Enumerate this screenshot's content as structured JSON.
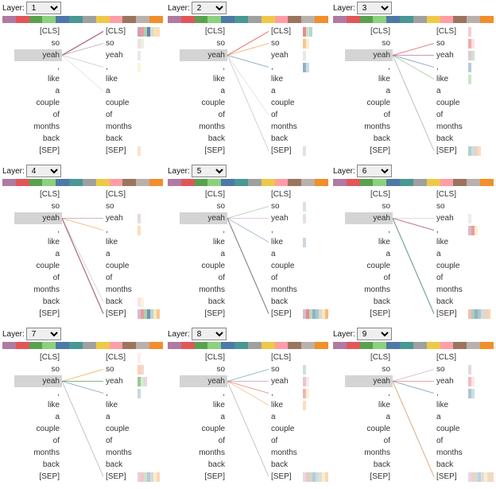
{
  "label_prefix": "Layer:",
  "layers": [
    "1",
    "2",
    "3",
    "4",
    "5",
    "6",
    "7",
    "8",
    "9"
  ],
  "tokens": [
    "[CLS]",
    "so",
    "yeah",
    ",",
    "like",
    "a",
    "couple",
    "of",
    "months",
    "back",
    "[SEP]"
  ],
  "selected_src_idx": 2,
  "head_colors": [
    "#b07aa1",
    "#e15759",
    "#59a14f",
    "#8cd17d",
    "#4e79a7",
    "#499894",
    "#a0a0a0",
    "#edc948",
    "#ff9da7",
    "#9c755f",
    "#bab0ac",
    "#f28e2b"
  ],
  "panels": [
    {
      "highlight_targets": [
        0
      ],
      "lines": [
        {
          "t": 0,
          "stroke": "#4e79a7",
          "w": 1.4
        },
        {
          "t": 0,
          "stroke": "#e15759",
          "w": 1.0
        },
        {
          "t": 1,
          "stroke": "#b07aa1",
          "w": 0.7
        },
        {
          "t": 3,
          "stroke": "#a0a0a0",
          "w": 0.6
        },
        {
          "t": 5,
          "stroke": "#bab0ac",
          "w": 0.5
        }
      ],
      "heads": {
        "0": [
          {
            "c": "#b07aa1",
            "a": 0.7
          },
          {
            "c": "#e15759",
            "a": 0.6
          },
          {
            "c": "#59a14f",
            "a": 0.5
          },
          {
            "c": "#4e79a7",
            "a": 0.9
          },
          {
            "c": "#a0a0a0",
            "a": 0.4
          },
          {
            "c": "#edc948",
            "a": 0.5
          },
          {
            "c": "#f28e2b",
            "a": 0.3
          }
        ],
        "1": [
          {
            "c": "#e15759",
            "a": 0.2
          },
          {
            "c": "#59a14f",
            "a": 0.15
          }
        ],
        "2": [
          {
            "c": "#4e79a7",
            "a": 0.15
          }
        ],
        "3": [
          {
            "c": "#edc948",
            "a": 0.2
          }
        ],
        "10": [
          {
            "c": "#f28e2b",
            "a": 0.25
          }
        ]
      }
    },
    {
      "highlight_targets": [
        0
      ],
      "lines": [
        {
          "t": 0,
          "stroke": "#e15759",
          "w": 1.2
        },
        {
          "t": 1,
          "stroke": "#f28e2b",
          "w": 0.9
        },
        {
          "t": 3,
          "stroke": "#4e79a7",
          "w": 0.7
        },
        {
          "t": 7,
          "stroke": "#bab0ac",
          "w": 0.5
        },
        {
          "t": 10,
          "stroke": "#a0a0a0",
          "w": 0.6
        }
      ],
      "heads": {
        "0": [
          {
            "c": "#e15759",
            "a": 0.7
          },
          {
            "c": "#59a14f",
            "a": 0.3
          },
          {
            "c": "#499894",
            "a": 0.4
          }
        ],
        "1": [
          {
            "c": "#f28e2b",
            "a": 0.5
          },
          {
            "c": "#edc948",
            "a": 0.3
          }
        ],
        "2": [
          {
            "c": "#b07aa1",
            "a": 0.2
          }
        ],
        "3": [
          {
            "c": "#4e79a7",
            "a": 0.6
          },
          {
            "c": "#499894",
            "a": 0.3
          }
        ],
        "10": [
          {
            "c": "#a0a0a0",
            "a": 0.3
          }
        ]
      }
    },
    {
      "highlight_targets": [],
      "lines": [
        {
          "t": 1,
          "stroke": "#e15759",
          "w": 1.0
        },
        {
          "t": 2,
          "stroke": "#b07aa1",
          "w": 0.9
        },
        {
          "t": 3,
          "stroke": "#4e79a7",
          "w": 0.8
        },
        {
          "t": 4,
          "stroke": "#59a14f",
          "w": 0.6
        },
        {
          "t": 10,
          "stroke": "#a0a0a0",
          "w": 0.9
        }
      ],
      "heads": {
        "0": [
          {
            "c": "#e15759",
            "a": 0.3
          }
        ],
        "1": [
          {
            "c": "#e15759",
            "a": 0.5
          },
          {
            "c": "#ff9da7",
            "a": 0.3
          }
        ],
        "2": [
          {
            "c": "#b07aa1",
            "a": 0.4
          },
          {
            "c": "#59a14f",
            "a": 0.3
          }
        ],
        "3": [
          {
            "c": "#4e79a7",
            "a": 0.4
          }
        ],
        "4": [
          {
            "c": "#59a14f",
            "a": 0.3
          }
        ],
        "10": [
          {
            "c": "#499894",
            "a": 0.45
          },
          {
            "c": "#a0a0a0",
            "a": 0.4
          },
          {
            "c": "#9c755f",
            "a": 0.3
          },
          {
            "c": "#f28e2b",
            "a": 0.3
          }
        ]
      }
    },
    {
      "highlight_targets": [
        10
      ],
      "lines": [
        {
          "t": 2,
          "stroke": "#b07aa1",
          "w": 0.7
        },
        {
          "t": 3,
          "stroke": "#f28e2b",
          "w": 0.7
        },
        {
          "t": 9,
          "stroke": "#bab0ac",
          "w": 0.6
        },
        {
          "t": 10,
          "stroke": "#4e79a7",
          "w": 1.3
        },
        {
          "t": 10,
          "stroke": "#e15759",
          "w": 0.9
        }
      ],
      "heads": {
        "2": [
          {
            "c": "#b07aa1",
            "a": 0.3
          }
        ],
        "3": [
          {
            "c": "#f28e2b",
            "a": 0.3
          }
        ],
        "9": [
          {
            "c": "#ff9da7",
            "a": 0.3
          },
          {
            "c": "#edc948",
            "a": 0.2
          }
        ],
        "10": [
          {
            "c": "#b07aa1",
            "a": 0.5
          },
          {
            "c": "#e15759",
            "a": 0.6
          },
          {
            "c": "#59a14f",
            "a": 0.5
          },
          {
            "c": "#4e79a7",
            "a": 0.8
          },
          {
            "c": "#499894",
            "a": 0.4
          },
          {
            "c": "#edc948",
            "a": 0.4
          },
          {
            "c": "#f28e2b",
            "a": 0.5
          }
        ]
      }
    },
    {
      "highlight_targets": [
        10
      ],
      "lines": [
        {
          "t": 1,
          "stroke": "#59a14f",
          "w": 0.6
        },
        {
          "t": 2,
          "stroke": "#b07aa1",
          "w": 0.6
        },
        {
          "t": 4,
          "stroke": "#4e79a7",
          "w": 0.7
        },
        {
          "t": 10,
          "stroke": "#e15759",
          "w": 1.2
        },
        {
          "t": 10,
          "stroke": "#499894",
          "w": 0.9
        }
      ],
      "heads": {
        "1": [
          {
            "c": "#59a14f",
            "a": 0.25
          }
        ],
        "2": [
          {
            "c": "#b07aa1",
            "a": 0.25
          }
        ],
        "4": [
          {
            "c": "#4e79a7",
            "a": 0.3
          }
        ],
        "10": [
          {
            "c": "#b07aa1",
            "a": 0.5
          },
          {
            "c": "#e15759",
            "a": 0.7
          },
          {
            "c": "#59a14f",
            "a": 0.4
          },
          {
            "c": "#4e79a7",
            "a": 0.6
          },
          {
            "c": "#499894",
            "a": 0.5
          },
          {
            "c": "#a0a0a0",
            "a": 0.4
          },
          {
            "c": "#edc948",
            "a": 0.4
          },
          {
            "c": "#f28e2b",
            "a": 0.6
          }
        ]
      }
    },
    {
      "highlight_targets": [
        3,
        10
      ],
      "lines": [
        {
          "t": 3,
          "stroke": "#e15759",
          "w": 1.1
        },
        {
          "t": 3,
          "stroke": "#b07aa1",
          "w": 0.8
        },
        {
          "t": 2,
          "stroke": "#a0a0a0",
          "w": 0.5
        },
        {
          "t": 10,
          "stroke": "#4e79a7",
          "w": 1.0
        },
        {
          "t": 10,
          "stroke": "#59a14f",
          "w": 0.7
        }
      ],
      "heads": {
        "2": [
          {
            "c": "#a0a0a0",
            "a": 0.2
          }
        ],
        "3": [
          {
            "c": "#b07aa1",
            "a": 0.5
          },
          {
            "c": "#e15759",
            "a": 0.6
          },
          {
            "c": "#edc948",
            "a": 0.3
          }
        ],
        "10": [
          {
            "c": "#e15759",
            "a": 0.4
          },
          {
            "c": "#59a14f",
            "a": 0.5
          },
          {
            "c": "#4e79a7",
            "a": 0.6
          },
          {
            "c": "#499894",
            "a": 0.5
          },
          {
            "c": "#a0a0a0",
            "a": 0.4
          },
          {
            "c": "#9c755f",
            "a": 0.3
          },
          {
            "c": "#f28e2b",
            "a": 0.4
          }
        ]
      }
    },
    {
      "highlight_targets": [],
      "lines": [
        {
          "t": 1,
          "stroke": "#f28e2b",
          "w": 0.8
        },
        {
          "t": 2,
          "stroke": "#59a14f",
          "w": 1.0
        },
        {
          "t": 3,
          "stroke": "#4e79a7",
          "w": 0.7
        },
        {
          "t": 10,
          "stroke": "#a0a0a0",
          "w": 0.8
        }
      ],
      "heads": {
        "0": [
          {
            "c": "#ff9da7",
            "a": 0.2
          }
        ],
        "1": [
          {
            "c": "#f28e2b",
            "a": 0.4
          },
          {
            "c": "#e15759",
            "a": 0.25
          }
        ],
        "2": [
          {
            "c": "#59a14f",
            "a": 0.6
          },
          {
            "c": "#8cd17d",
            "a": 0.4
          },
          {
            "c": "#b07aa1",
            "a": 0.3
          }
        ],
        "3": [
          {
            "c": "#4e79a7",
            "a": 0.3
          }
        ],
        "10": [
          {
            "c": "#b07aa1",
            "a": 0.35
          },
          {
            "c": "#e15759",
            "a": 0.35
          },
          {
            "c": "#59a14f",
            "a": 0.3
          },
          {
            "c": "#4e79a7",
            "a": 0.4
          },
          {
            "c": "#a0a0a0",
            "a": 0.4
          },
          {
            "c": "#edc948",
            "a": 0.3
          },
          {
            "c": "#f28e2b",
            "a": 0.35
          }
        ]
      }
    },
    {
      "highlight_targets": [],
      "lines": [
        {
          "t": 1,
          "stroke": "#499894",
          "w": 0.7
        },
        {
          "t": 2,
          "stroke": "#b07aa1",
          "w": 0.8
        },
        {
          "t": 3,
          "stroke": "#e15759",
          "w": 0.9
        },
        {
          "t": 4,
          "stroke": "#f28e2b",
          "w": 0.6
        },
        {
          "t": 10,
          "stroke": "#a0a0a0",
          "w": 0.8
        }
      ],
      "heads": {
        "1": [
          {
            "c": "#499894",
            "a": 0.3
          }
        ],
        "2": [
          {
            "c": "#b07aa1",
            "a": 0.4
          },
          {
            "c": "#ff9da7",
            "a": 0.25
          }
        ],
        "3": [
          {
            "c": "#e15759",
            "a": 0.45
          },
          {
            "c": "#edc948",
            "a": 0.25
          }
        ],
        "4": [
          {
            "c": "#f28e2b",
            "a": 0.3
          }
        ],
        "10": [
          {
            "c": "#b07aa1",
            "a": 0.3
          },
          {
            "c": "#e15759",
            "a": 0.35
          },
          {
            "c": "#59a14f",
            "a": 0.35
          },
          {
            "c": "#4e79a7",
            "a": 0.4
          },
          {
            "c": "#499894",
            "a": 0.3
          },
          {
            "c": "#a0a0a0",
            "a": 0.35
          },
          {
            "c": "#edc948",
            "a": 0.3
          },
          {
            "c": "#f28e2b",
            "a": 0.35
          }
        ]
      }
    },
    {
      "highlight_targets": [],
      "lines": [
        {
          "t": 2,
          "stroke": "#e15759",
          "w": 0.8
        },
        {
          "t": 3,
          "stroke": "#4e79a7",
          "w": 0.9
        },
        {
          "t": 1,
          "stroke": "#b07aa1",
          "w": 0.6
        },
        {
          "t": 10,
          "stroke": "#a0a0a0",
          "w": 0.8
        },
        {
          "t": 10,
          "stroke": "#f28e2b",
          "w": 0.6
        }
      ],
      "heads": {
        "1": [
          {
            "c": "#b07aa1",
            "a": 0.3
          }
        ],
        "2": [
          {
            "c": "#e15759",
            "a": 0.4
          },
          {
            "c": "#ff9da7",
            "a": 0.25
          }
        ],
        "3": [
          {
            "c": "#4e79a7",
            "a": 0.45
          },
          {
            "c": "#499894",
            "a": 0.3
          }
        ],
        "10": [
          {
            "c": "#b07aa1",
            "a": 0.3
          },
          {
            "c": "#e15759",
            "a": 0.3
          },
          {
            "c": "#59a14f",
            "a": 0.3
          },
          {
            "c": "#4e79a7",
            "a": 0.35
          },
          {
            "c": "#a0a0a0",
            "a": 0.35
          },
          {
            "c": "#edc948",
            "a": 0.3
          },
          {
            "c": "#9c755f",
            "a": 0.25
          },
          {
            "c": "#f28e2b",
            "a": 0.35
          }
        ]
      }
    }
  ]
}
